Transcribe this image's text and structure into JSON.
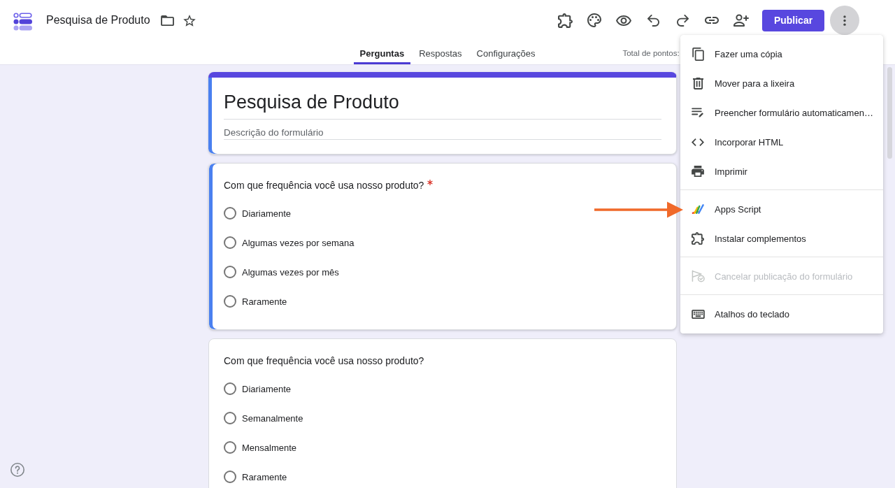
{
  "header": {
    "title": "Pesquisa de Produto",
    "publish_button": "Publicar"
  },
  "tabs": [
    {
      "label": "Perguntas",
      "selected": true
    },
    {
      "label": "Respostas",
      "selected": false
    },
    {
      "label": "Configurações",
      "selected": false
    }
  ],
  "total_points": "Total de pontos:",
  "form": {
    "selected": true,
    "title": "Pesquisa de Produto",
    "description": {
      "placeholder": "Descrição do formulário"
    }
  },
  "questions": [
    {
      "title": "Com que frequência você usa nosso produto?",
      "required": true,
      "selected": true,
      "options": [
        {
          "label": "Diariamente",
          "selected": false
        },
        {
          "label": "Algumas vezes por semana",
          "selected": false
        },
        {
          "label": "Algumas vezes por mês",
          "selected": false
        },
        {
          "label": "Raramente",
          "selected": false
        }
      ]
    },
    {
      "title": "Com que frequência você usa nosso produto?",
      "required": false,
      "selected": false,
      "options": [
        {
          "label": "Diariamente",
          "selected": false
        },
        {
          "label": "Semanalmente",
          "selected": false
        },
        {
          "label": "Mensalmente",
          "selected": false
        },
        {
          "label": "Raramente",
          "selected": false
        }
      ]
    }
  ],
  "menu": {
    "open": true,
    "groups": [
      [
        {
          "label": "Fazer uma cópia",
          "disabled": false
        },
        {
          "label": "Mover para a lixeira",
          "disabled": false
        },
        {
          "label": "Preencher formulário automaticamen…",
          "disabled": false
        },
        {
          "label": "Incorporar HTML",
          "disabled": false
        },
        {
          "label": "Imprimir",
          "disabled": false
        }
      ],
      [
        {
          "label": "Apps Script",
          "disabled": false
        },
        {
          "label": "Instalar complementos",
          "disabled": false
        }
      ],
      [
        {
          "label": "Cancelar publicação do formulário",
          "disabled": true
        }
      ],
      [
        {
          "label": "Atalhos do teclado",
          "disabled": false
        }
      ]
    ]
  }
}
